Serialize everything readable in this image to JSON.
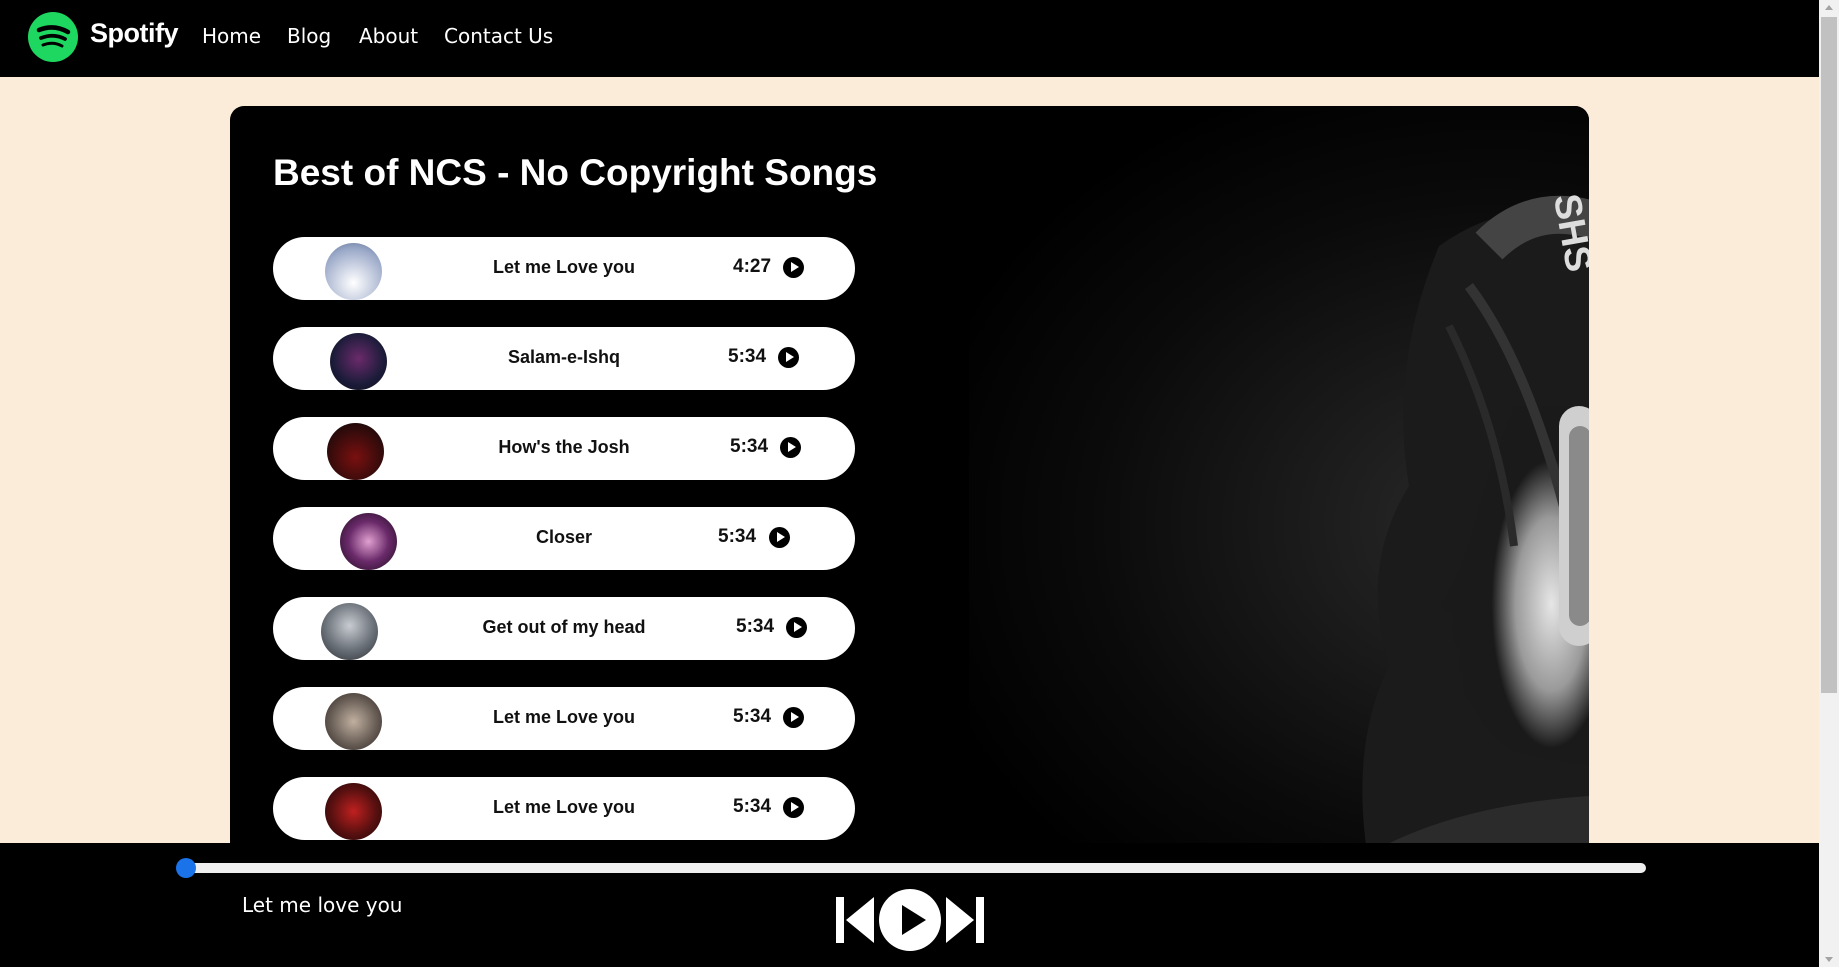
{
  "nav": {
    "brand": "Spotify",
    "links": [
      "Home",
      "Blog",
      "About",
      "Contact Us"
    ]
  },
  "main": {
    "title": "Best of NCS - No Copyright Songs",
    "songs": [
      {
        "name": "Let me Love you",
        "duration": "4:27",
        "cover_color": "#c9d2e4"
      },
      {
        "name": "Salam-e-Ishq",
        "duration": "5:34",
        "cover_color": "#1c1c3a"
      },
      {
        "name": "How's the Josh",
        "duration": "5:34",
        "cover_color": "#3a0b0b"
      },
      {
        "name": "Closer",
        "duration": "5:34",
        "cover_color": "#3a1e3e"
      },
      {
        "name": "Get out of my head",
        "duration": "5:34",
        "cover_color": "#6a7078"
      },
      {
        "name": "Let me Love you",
        "duration": "5:34",
        "cover_color": "#6b6058"
      },
      {
        "name": "Let me Love you",
        "duration": "5:34",
        "cover_color": "#2a0d0d"
      }
    ]
  },
  "player": {
    "now_playing": "Let me love you",
    "progress_fraction": 0.0,
    "accent": "#1a73e8"
  },
  "colors": {
    "spotify_green": "#1ed760",
    "page_bg": "#fbebd9"
  }
}
